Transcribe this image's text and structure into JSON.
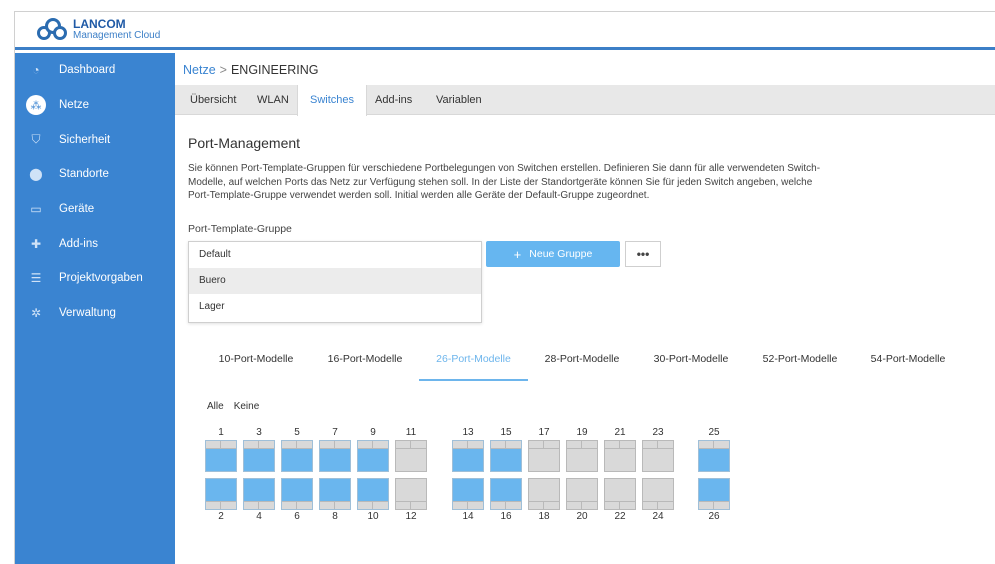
{
  "app": {
    "brand": "LANCOM",
    "subtitle": "Management Cloud"
  },
  "sidebar": {
    "items": [
      {
        "label": "Dashboard",
        "icon": "dashboard-icon"
      },
      {
        "label": "Netze",
        "icon": "network-icon",
        "active": true
      },
      {
        "label": "Sicherheit",
        "icon": "shield-icon"
      },
      {
        "label": "Standorte",
        "icon": "location-pin-icon"
      },
      {
        "label": "Geräte",
        "icon": "devices-icon"
      },
      {
        "label": "Add-ins",
        "icon": "puzzle-icon"
      },
      {
        "label": "Projektvorgaben",
        "icon": "sliders-icon"
      },
      {
        "label": "Verwaltung",
        "icon": "gear-icon"
      }
    ]
  },
  "breadcrumb": {
    "parent": "Netze",
    "separator": ">",
    "current": "ENGINEERING"
  },
  "tabs": [
    {
      "label": "Übersicht"
    },
    {
      "label": "WLAN"
    },
    {
      "label": "Switches",
      "active": true
    },
    {
      "label": "Add-ins"
    },
    {
      "label": "Variablen"
    }
  ],
  "port_management": {
    "title": "Port-Management",
    "description": "Sie können Port-Template-Gruppen für verschiedene Portbelegungen von Switchen erstellen. Definieren Sie dann für alle verwendeten Switch-Modelle, auf welchen Ports das Netz zur Verfügung stehen soll. In der Liste der Standortgeräte können Sie für jeden Switch angeben, welche Port-Template-Gruppe verwendet werden soll. Initial werden alle Geräte der Default-Gruppe zugeordnet.",
    "group_label": "Port-Template-Gruppe",
    "group_options": [
      "Default",
      "Buero",
      "Lager"
    ],
    "hovered_option": "Buero",
    "new_group_button": "Neue Gruppe",
    "more_button": "•••"
  },
  "model_tabs": [
    {
      "label": "10-Port-Modelle"
    },
    {
      "label": "16-Port-Modelle"
    },
    {
      "label": "26-Port-Modelle",
      "active": true
    },
    {
      "label": "28-Port-Modelle"
    },
    {
      "label": "30-Port-Modelle"
    },
    {
      "label": "52-Port-Modelle"
    },
    {
      "label": "54-Port-Modelle"
    }
  ],
  "selection": {
    "all": "Alle",
    "none": "Keine"
  },
  "ports": {
    "top_row": [
      {
        "n": "1",
        "on": true
      },
      {
        "n": "3",
        "on": true
      },
      {
        "n": "5",
        "on": true
      },
      {
        "n": "7",
        "on": true
      },
      {
        "n": "9",
        "on": true
      },
      {
        "n": "11",
        "on": false
      },
      {
        "n": "13",
        "on": true
      },
      {
        "n": "15",
        "on": true
      },
      {
        "n": "17",
        "on": false
      },
      {
        "n": "19",
        "on": false
      },
      {
        "n": "21",
        "on": false
      },
      {
        "n": "23",
        "on": false
      },
      {
        "n": "25",
        "on": true
      }
    ],
    "bottom_row": [
      {
        "n": "2",
        "on": true
      },
      {
        "n": "4",
        "on": true
      },
      {
        "n": "6",
        "on": true
      },
      {
        "n": "8",
        "on": true
      },
      {
        "n": "10",
        "on": true
      },
      {
        "n": "12",
        "on": false
      },
      {
        "n": "14",
        "on": true
      },
      {
        "n": "16",
        "on": true
      },
      {
        "n": "18",
        "on": false
      },
      {
        "n": "20",
        "on": false
      },
      {
        "n": "22",
        "on": false
      },
      {
        "n": "24",
        "on": false
      },
      {
        "n": "26",
        "on": true
      }
    ]
  },
  "colors": {
    "sidebar": "#3a84d1",
    "accent": "#6db5ec",
    "port_active": "#6ab6ee",
    "port_inactive": "#d9d9d9"
  }
}
